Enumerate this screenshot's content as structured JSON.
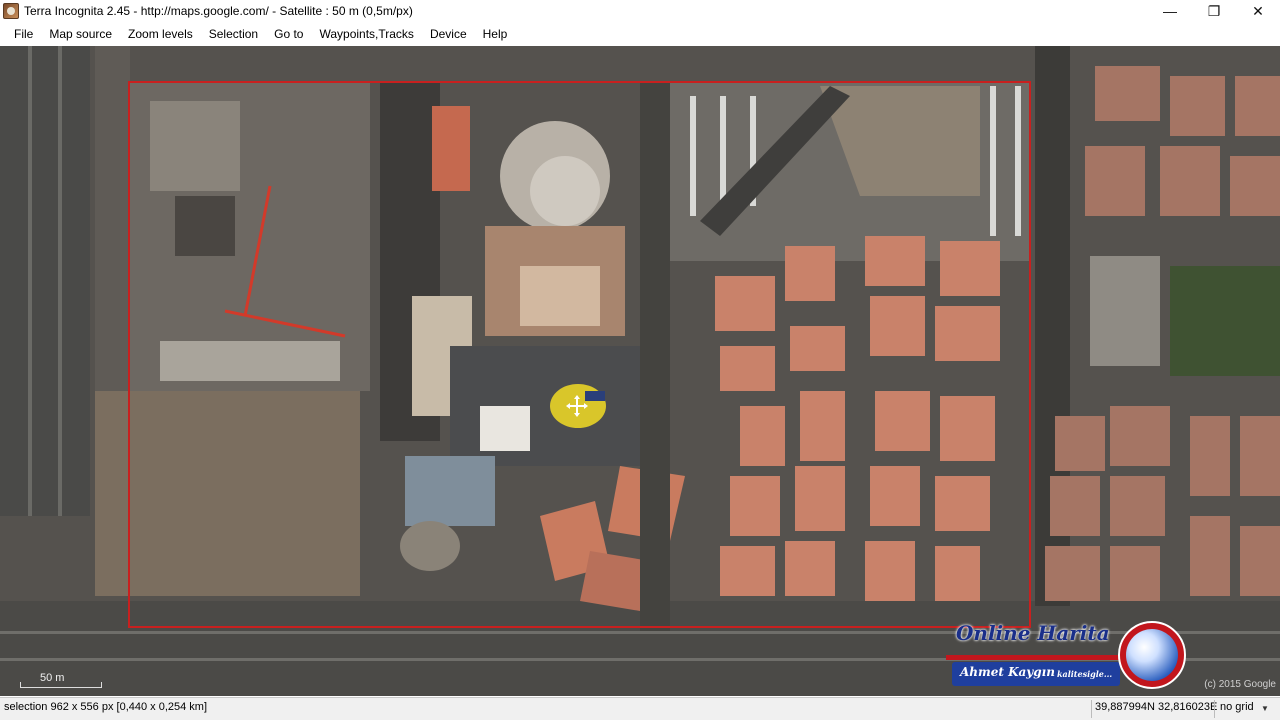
{
  "window": {
    "title": "Terra Incognita 2.45 - http://maps.google.com/ - Satellite : 50 m (0,5m/px)",
    "minimize_glyph": "—",
    "maximize_glyph": "❐",
    "close_glyph": "✕"
  },
  "menu": {
    "items": [
      "File",
      "Map source",
      "Zoom levels",
      "Selection",
      "Go to",
      "Waypoints,Tracks",
      "Device",
      "Help"
    ]
  },
  "map": {
    "view": "satellite",
    "selection_color": "#c8201f",
    "scale_label": "50 m",
    "copyright": "(c) 2015 Google"
  },
  "watermark": {
    "line1": "Online Harita",
    "name": "Ahmet Kaygın",
    "sub": "kalitesigle..."
  },
  "status": {
    "selection": "selection 962 x 556 px [0,440 x 0,254 km]",
    "coordinates": "39,887994N 32,816023E",
    "grid": "no grid"
  },
  "icons": {
    "app": "terra-incognita-app-icon",
    "move_cursor": "move-cursor-icon",
    "dropdown": "chevron-down-icon"
  }
}
